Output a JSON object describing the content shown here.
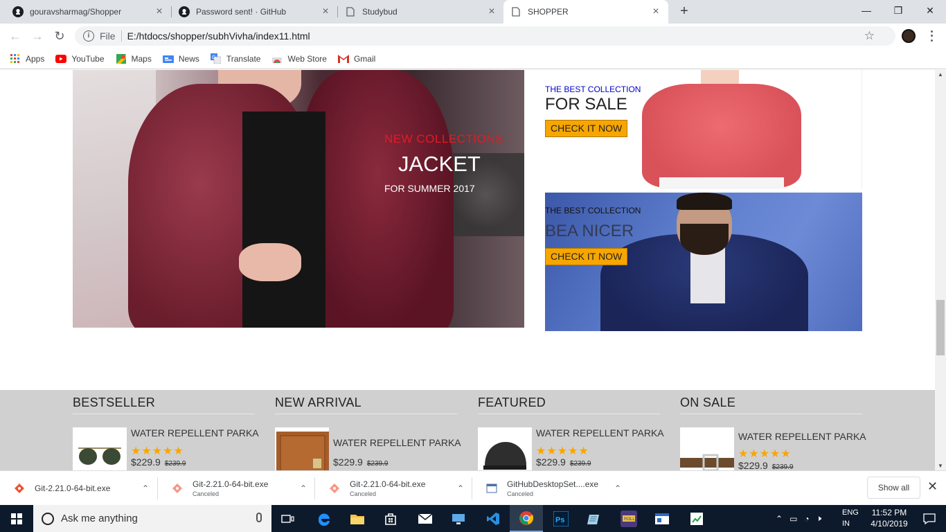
{
  "browser": {
    "tabs": [
      {
        "title": "gouravsharmag/Shopper",
        "icon": "github-icon"
      },
      {
        "title": "Password sent! · GitHub",
        "icon": "github-icon"
      },
      {
        "title": "Studybud",
        "icon": "page-icon"
      },
      {
        "title": "SHOPPER",
        "icon": "page-icon",
        "active": true
      }
    ],
    "new_tab": "+",
    "window_controls": {
      "minimize": "—",
      "restore": "❐",
      "close": "✕"
    },
    "address": {
      "scheme": "File",
      "url": "E:/htdocs/shopper/subhVivha/index11.html"
    },
    "bookmarks": [
      {
        "label": "Apps",
        "icon": "apps-grid-icon"
      },
      {
        "label": "YouTube",
        "icon": "youtube-icon"
      },
      {
        "label": "Maps",
        "icon": "maps-icon"
      },
      {
        "label": "News",
        "icon": "news-icon"
      },
      {
        "label": "Translate",
        "icon": "translate-icon"
      },
      {
        "label": "Web Store",
        "icon": "webstore-icon"
      },
      {
        "label": "Gmail",
        "icon": "gmail-icon"
      }
    ]
  },
  "hero": {
    "kicker": "NEW COLLECTIONS",
    "headline": "JACKET",
    "sub": "FOR SUMMER 2017"
  },
  "promos": [
    {
      "label": "THE BEST COLLECTION",
      "headline": "FOR SALE",
      "cta": "CHECK IT NOW",
      "label_color": "#0000cc",
      "headline_color": "#222222"
    },
    {
      "label": "THE BEST COLLECTION",
      "headline": "BEA NICER",
      "cta": "CHECK IT NOW",
      "label_color": "#111111",
      "headline_color": "#333a55"
    }
  ],
  "products": [
    {
      "heading": "BESTSELLER",
      "item": {
        "name": "WATER REPELLENT PARKA",
        "rating": 5,
        "stars": "★★★★★",
        "price": "$229.9",
        "old_price": "$239.9",
        "thumb": "sunglasses"
      }
    },
    {
      "heading": "NEW ARRIVAL",
      "item": {
        "name": "WATER REPELLENT PARKA",
        "rating": 5,
        "stars": "★★★★★",
        "price": "$229.9",
        "old_price": "$239.9",
        "thumb": "wallet"
      }
    },
    {
      "heading": "FEATURED",
      "item": {
        "name": "WATER REPELLENT PARKA",
        "rating": 5,
        "stars": "★★★★★",
        "price": "$229.9",
        "old_price": "$239.9",
        "thumb": "cap"
      }
    },
    {
      "heading": "ON SALE",
      "item": {
        "name": "WATER REPELLENT PARKA",
        "rating": 5,
        "stars": "★★★★★",
        "price": "$229.9",
        "old_price": "$239.9",
        "thumb": "belt"
      }
    }
  ],
  "downloads": {
    "items": [
      {
        "file": "Git-2.21.0-64-bit.exe",
        "status": ""
      },
      {
        "file": "Git-2.21.0-64-bit.exe",
        "status": "Canceled"
      },
      {
        "file": "Git-2.21.0-64-bit.exe",
        "status": "Canceled"
      },
      {
        "file": "GitHubDesktopSet....exe",
        "status": "Canceled"
      }
    ],
    "show_all": "Show all"
  },
  "taskbar": {
    "search_placeholder": "Ask me anything",
    "lang_line1": "ENG",
    "lang_line2": "IN",
    "time": "11:52 PM",
    "date": "4/10/2019",
    "accent": "#0d1a2b"
  },
  "colors": {
    "cta": "#f7a600",
    "kicker": "#e31b23",
    "stars": "#f7a600",
    "product_band": "#d0d0d0"
  }
}
